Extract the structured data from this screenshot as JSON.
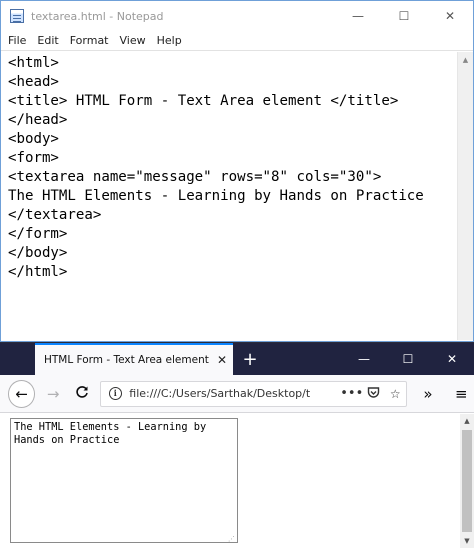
{
  "notepad": {
    "title": "textarea.html - Notepad",
    "window_buttons": {
      "minimize": "—",
      "maximize": "☐",
      "close": "✕"
    },
    "menu": [
      "File",
      "Edit",
      "Format",
      "View",
      "Help"
    ],
    "lines": [
      "<html>",
      "<head>",
      "<title> HTML Form - Text Area element </title>",
      "</head>",
      "<body>",
      "<form>",
      "<textarea name=\"message\" rows=\"8\" cols=\"30\">",
      "The HTML Elements - Learning by Hands on Practice",
      "</textarea>",
      "</form>",
      "</body>",
      "</html>"
    ]
  },
  "browser": {
    "tab_title": "HTML Form - Text Area element",
    "tab_close": "✕",
    "new_tab": "+",
    "window_buttons": {
      "minimize": "—",
      "maximize": "☐",
      "close": "✕"
    },
    "nav": {
      "back": "←",
      "forward": "→",
      "reload": "C"
    },
    "url": "file:///C:/Users/Sarthak/Desktop/t",
    "url_icons": {
      "more": "•••",
      "pocket": "♡",
      "bookmark": "☆"
    },
    "toolbar": {
      "overflow": "»",
      "menu": "≡"
    },
    "textarea_value": "The HTML Elements - Learning by Hands on Practice"
  }
}
